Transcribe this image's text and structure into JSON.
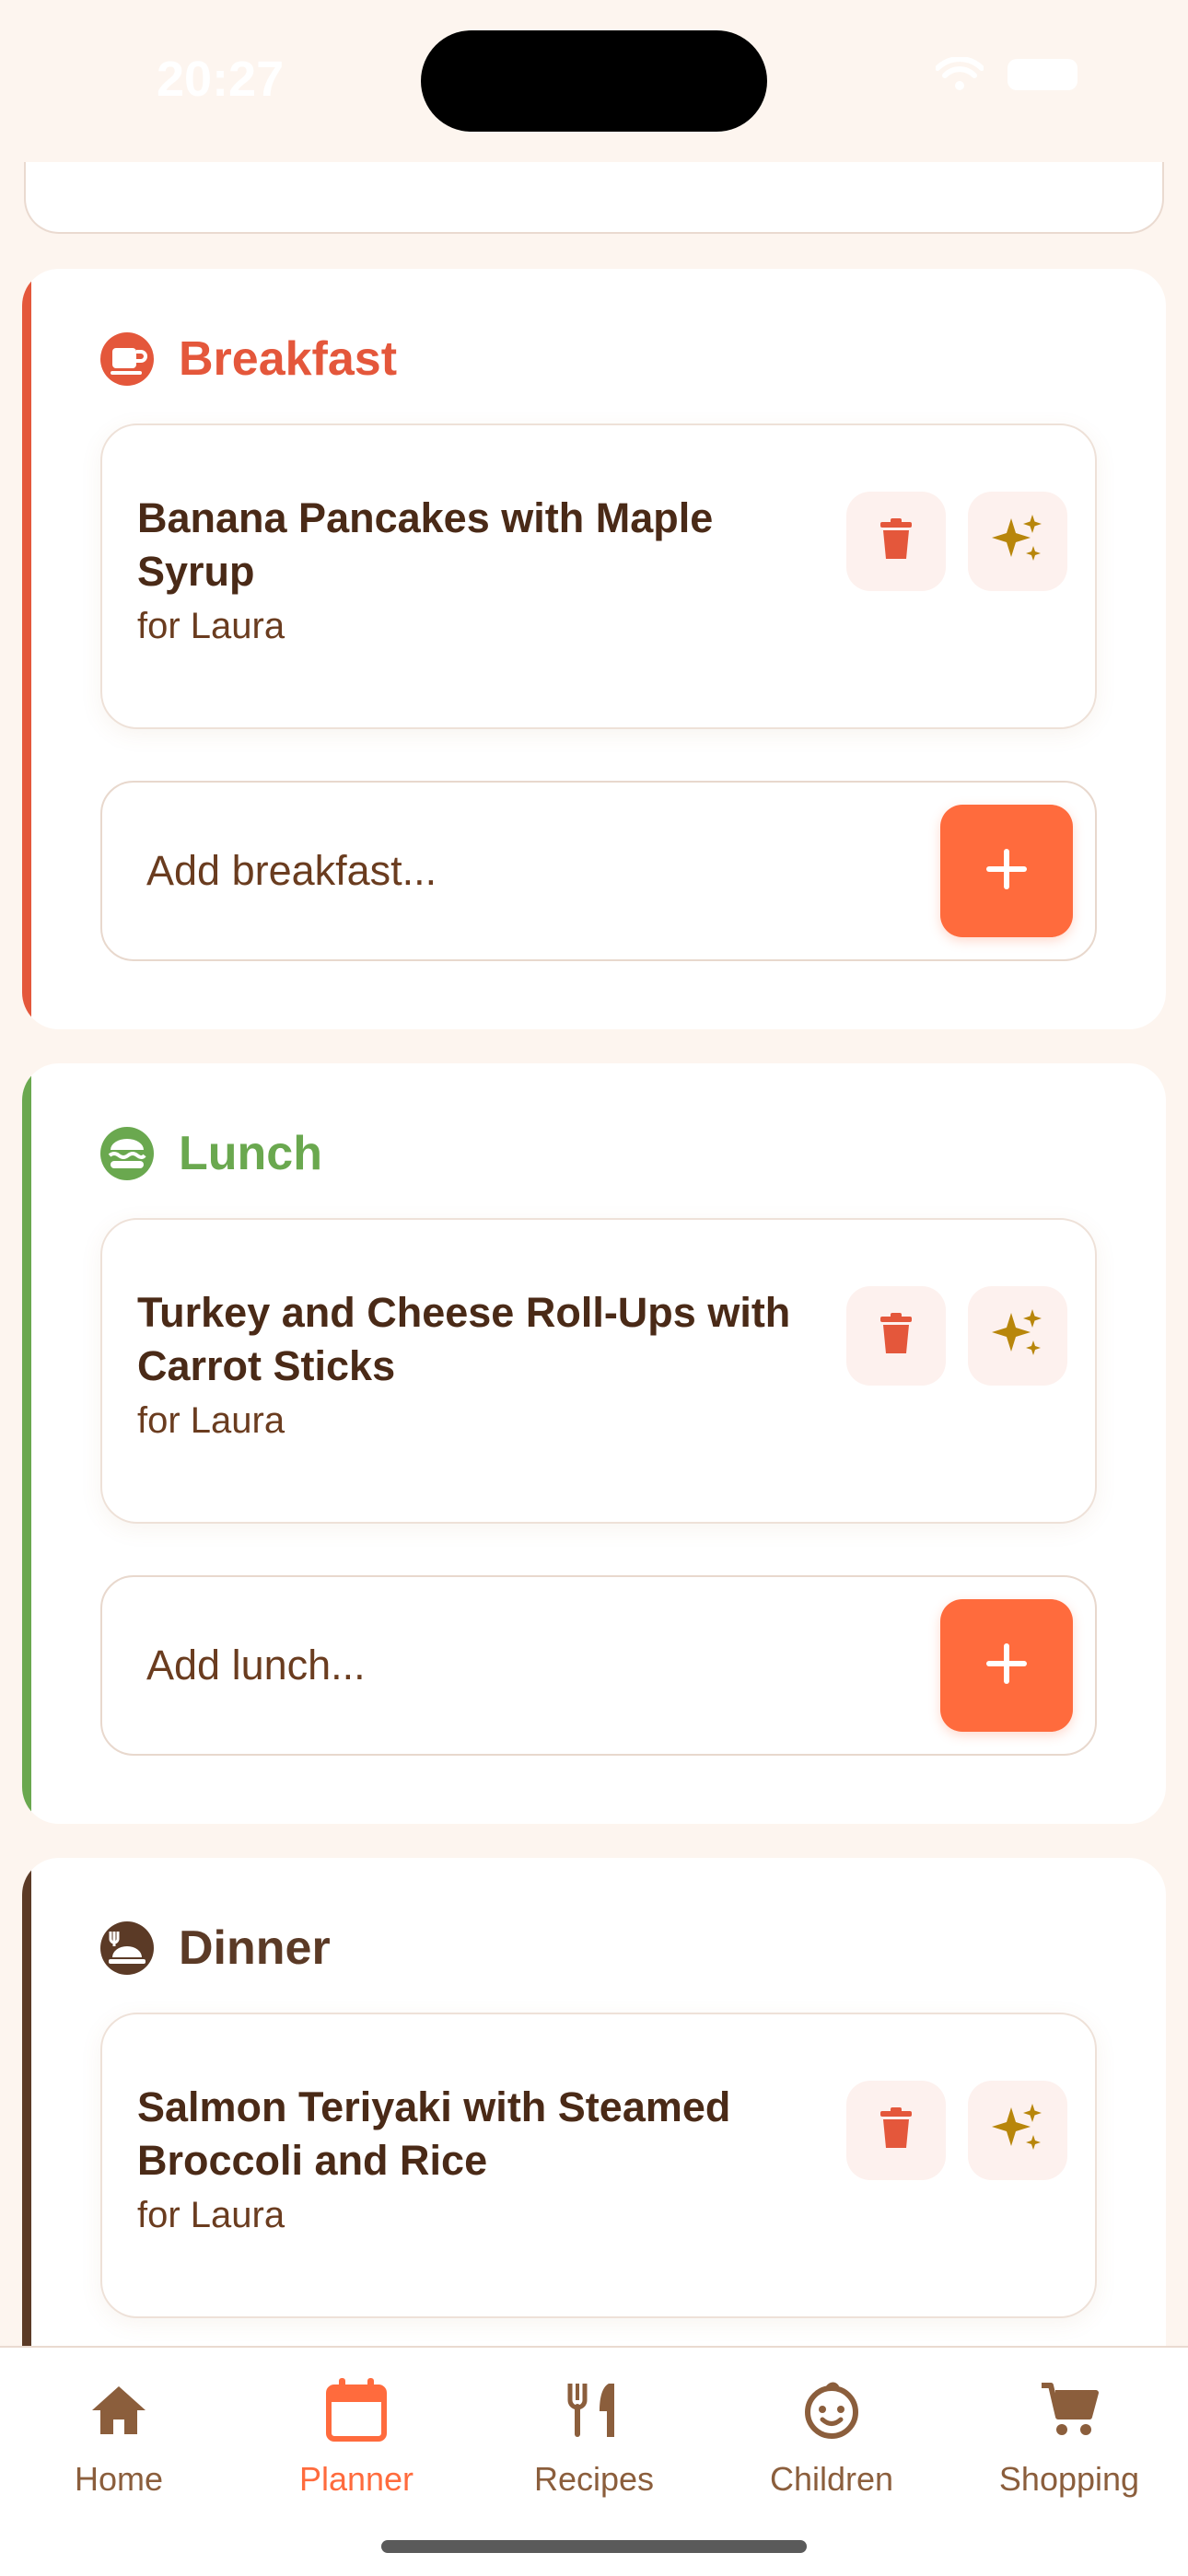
{
  "status": {
    "time": "20:27"
  },
  "meals": [
    {
      "title": "Breakfast",
      "accent": "#E4573B",
      "icon": "coffee-cup-icon",
      "item": {
        "name": "Banana Pancakes with Maple Syrup",
        "for": "for Laura"
      },
      "placeholder": "Add breakfast..."
    },
    {
      "title": "Lunch",
      "accent": "#6AA84F",
      "icon": "burger-icon",
      "item": {
        "name": "Turkey and Cheese Roll-Ups with Carrot Sticks",
        "for": "for Laura"
      },
      "placeholder": "Add lunch..."
    },
    {
      "title": "Dinner",
      "accent": "#5B3A26",
      "icon": "dinner-plate-icon",
      "item": {
        "name": "Salmon Teriyaki with Steamed Broccoli and Rice",
        "for": "for Laura"
      },
      "placeholder": ""
    }
  ],
  "tabs": [
    {
      "label": "Home",
      "icon": "home-icon"
    },
    {
      "label": "Planner",
      "icon": "calendar-icon",
      "active": true
    },
    {
      "label": "Recipes",
      "icon": "fork-knife-icon"
    },
    {
      "label": "Children",
      "icon": "child-face-icon"
    },
    {
      "label": "Shopping",
      "icon": "cart-icon"
    }
  ],
  "colors": {
    "primary": "#FF6B3D",
    "background": "#FDF5EF",
    "brown": "#8B5E3C",
    "gold": "#B8860B"
  }
}
